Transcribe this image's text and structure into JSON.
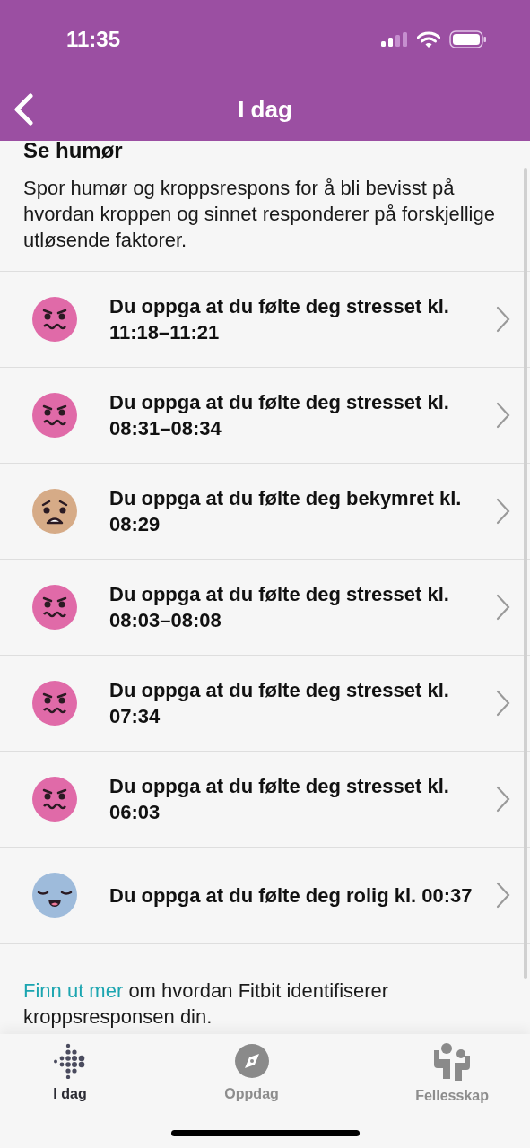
{
  "status_bar": {
    "time": "11:35"
  },
  "nav": {
    "title": "I dag"
  },
  "section": {
    "title": "Se humør",
    "description": "Spor humør og kroppsrespons for å bli bevisst på hvordan kroppen og sinnet responderer på forskjellige utløsende faktorer."
  },
  "entries": [
    {
      "kind": "stressed",
      "text": "Du oppga at du følte deg stresset kl. 11:18–11:21"
    },
    {
      "kind": "stressed",
      "text": "Du oppga at du følte deg stresset kl. 08:31–08:34"
    },
    {
      "kind": "worried",
      "text": "Du oppga at du følte deg bekymret kl. 08:29"
    },
    {
      "kind": "stressed",
      "text": "Du oppga at du følte deg stresset kl. 08:03–08:08"
    },
    {
      "kind": "stressed",
      "text": "Du oppga at du følte deg stresset kl. 07:34"
    },
    {
      "kind": "stressed",
      "text": "Du oppga at du følte deg stresset kl. 06:03"
    },
    {
      "kind": "calm",
      "text": "Du oppga at du følte deg rolig kl. 00:37"
    }
  ],
  "footer_note": {
    "link": "Finn ut mer",
    "text": "om hvordan Fitbit identifiserer kroppsresponsen din."
  },
  "tabs": [
    {
      "kind": "today",
      "label": "I dag",
      "selected": true
    },
    {
      "kind": "discover",
      "label": "Oppdag",
      "selected": false
    },
    {
      "kind": "community",
      "label": "Fellesskap",
      "selected": false
    }
  ]
}
